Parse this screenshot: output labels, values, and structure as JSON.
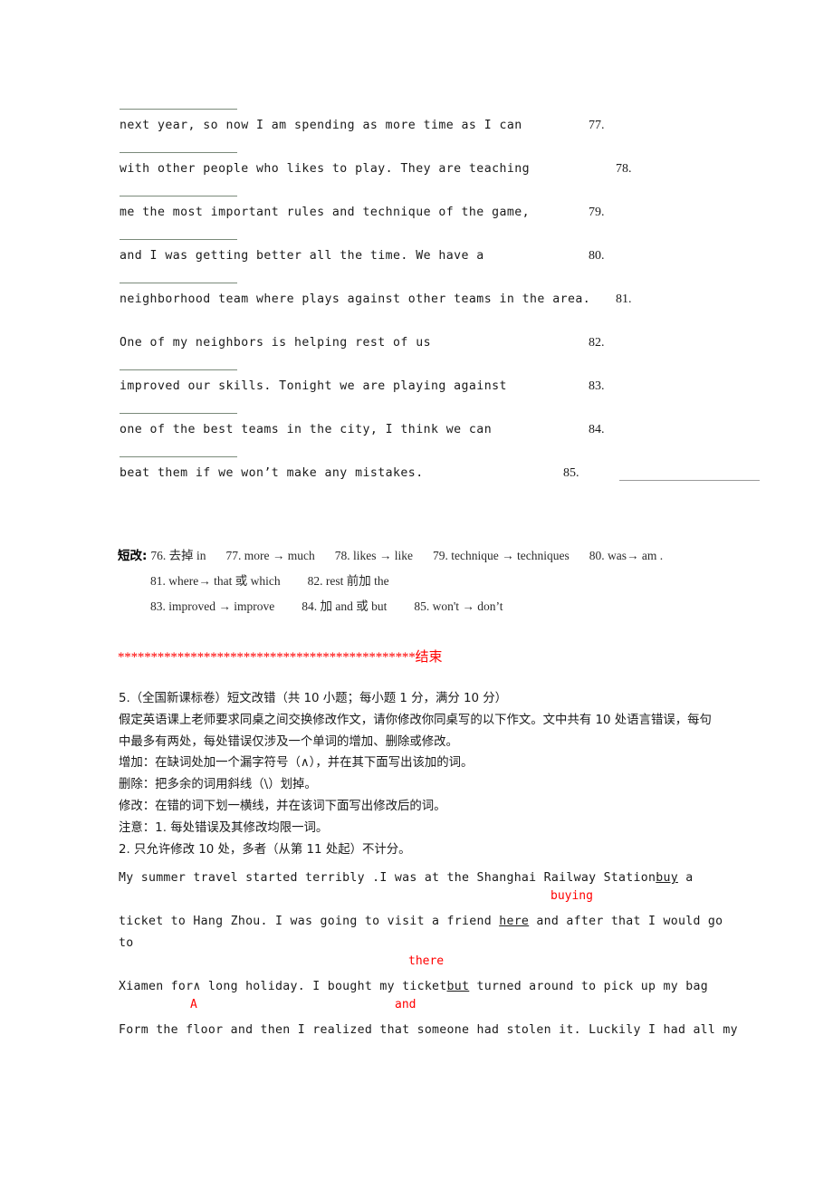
{
  "exercise": {
    "rows": [
      {
        "text": "next year, so now I am spending as more time as I can",
        "number": "77.",
        "col": "c1",
        "rule": true,
        "blank": false
      },
      {
        "text": "with other people who likes to play. They are teaching",
        "number": "78.",
        "col": "c2",
        "rule": true,
        "blank": false
      },
      {
        "text": "me the most important rules and technique of the game,",
        "number": "79.",
        "col": "c1",
        "rule": true,
        "blank": false
      },
      {
        "text": "and I was getting better all the time. We have a",
        "number": "80.",
        "col": "c1",
        "rule": true,
        "blank": false
      },
      {
        "text": "neighborhood team where plays against other teams in the area.",
        "number": "81.",
        "col": "c2",
        "rule": true,
        "blank": false
      },
      {
        "text": "One of my neighbors is helping rest of us",
        "number": "82.",
        "col": "c1",
        "rule": false,
        "blank": false
      },
      {
        "text": "improved our skills. Tonight we are playing against",
        "number": "83.",
        "col": "c1",
        "rule": true,
        "blank": false
      },
      {
        "text": "one of the best teams in the city, I think we can",
        "number": "84.",
        "col": "c1",
        "rule": true,
        "blank": false
      },
      {
        "text": "beat them if we won’t make any mistakes.",
        "number": "85.",
        "col": "c1",
        "rule": true,
        "blank": true
      }
    ]
  },
  "answer_key": {
    "label": "短改:",
    "line1": [
      "76. 去掉 in",
      "77. more → much",
      "78. likes → like",
      "79. technique → techniques",
      "80. was→ am ."
    ],
    "line2": [
      "81. where→ that 或 which",
      "82. rest 前加 the"
    ],
    "line3": [
      "83. improved → improve",
      "84. 加 and 或 but",
      "85. won't → don’t"
    ]
  },
  "divider": {
    "asterisks": "*********************************************",
    "end_label": "结束"
  },
  "instructions": {
    "lines": [
      "5.（全国新课标卷）短文改错（共 10 小题；每小题 1 分，满分 10 分）",
      "假定英语课上老师要求同桌之间交换修改作文，请你修改你同桌写的以下作文。文中共有 10 处语言错误，每句中最多有两处，每处错误仅涉及一个单词的增加、删除或修改。",
      "增加：在缺词处加一个漏字符号（∧），并在其下面写出该加的词。",
      "删除：把多余的词用斜线（\\）划掉。",
      "修改：在错的词下划一横线，并在该词下面写出修改后的词。",
      "注意：1. 每处错误及其修改均限一词。",
      "2. 只允许修改 10 处，多者（从第 11 处起）不计分。"
    ]
  },
  "passage": {
    "line1_a": "My summer travel started terribly .I was at the Shanghai Railway Station",
    "line1_u": "buy",
    "line1_b": " a",
    "fix1": "buying",
    "line2_a": "ticket to Hang Zhou. I was going to visit a friend ",
    "line2_u": "here",
    "line2_b": " and after that I would go to",
    "fix2": "there",
    "line3_a": "Xiamen for∧ long holiday. I bought my ticket",
    "line3_u": "but",
    "line3_b": " turned around to pick up my bag",
    "fix3a": "A",
    "fix3b": "and",
    "line4": "Form the floor and then I realized that someone had stolen it. Luckily I had all my"
  }
}
